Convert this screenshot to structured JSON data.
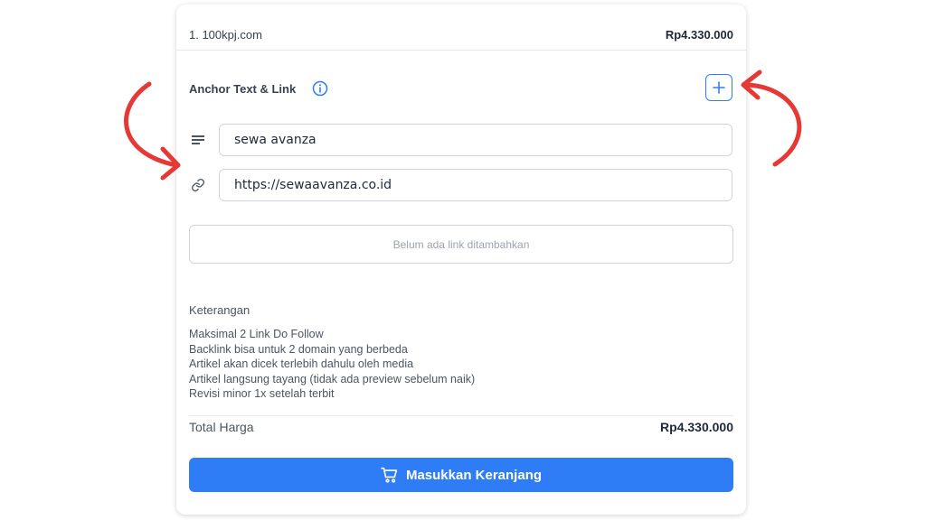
{
  "order": {
    "item_label": "1. 100kpj.com",
    "item_price": "Rp4.330.000"
  },
  "anchor": {
    "title": "Anchor Text & Link",
    "anchor_value": "sewa avanza",
    "link_value": "https://sewaavanza.co.id",
    "empty_message": "Belum ada link ditambahkan"
  },
  "notes": {
    "title": "Keterangan",
    "items": [
      "Maksimal 2 Link Do Follow",
      "Backlink bisa untuk 2 domain yang berbeda",
      "Artikel akan dicek terlebih dahulu oleh media",
      "Artikel langsung tayang (tidak ada preview sebelum naik)",
      "Revisi minor 1x setelah terbit"
    ]
  },
  "total": {
    "label": "Total Harga",
    "value": "Rp4.330.000"
  },
  "cart_button": {
    "label": "Masukkan Keranjang"
  },
  "colors": {
    "accent": "#2f7df6",
    "annotation_red": "#e53935"
  }
}
